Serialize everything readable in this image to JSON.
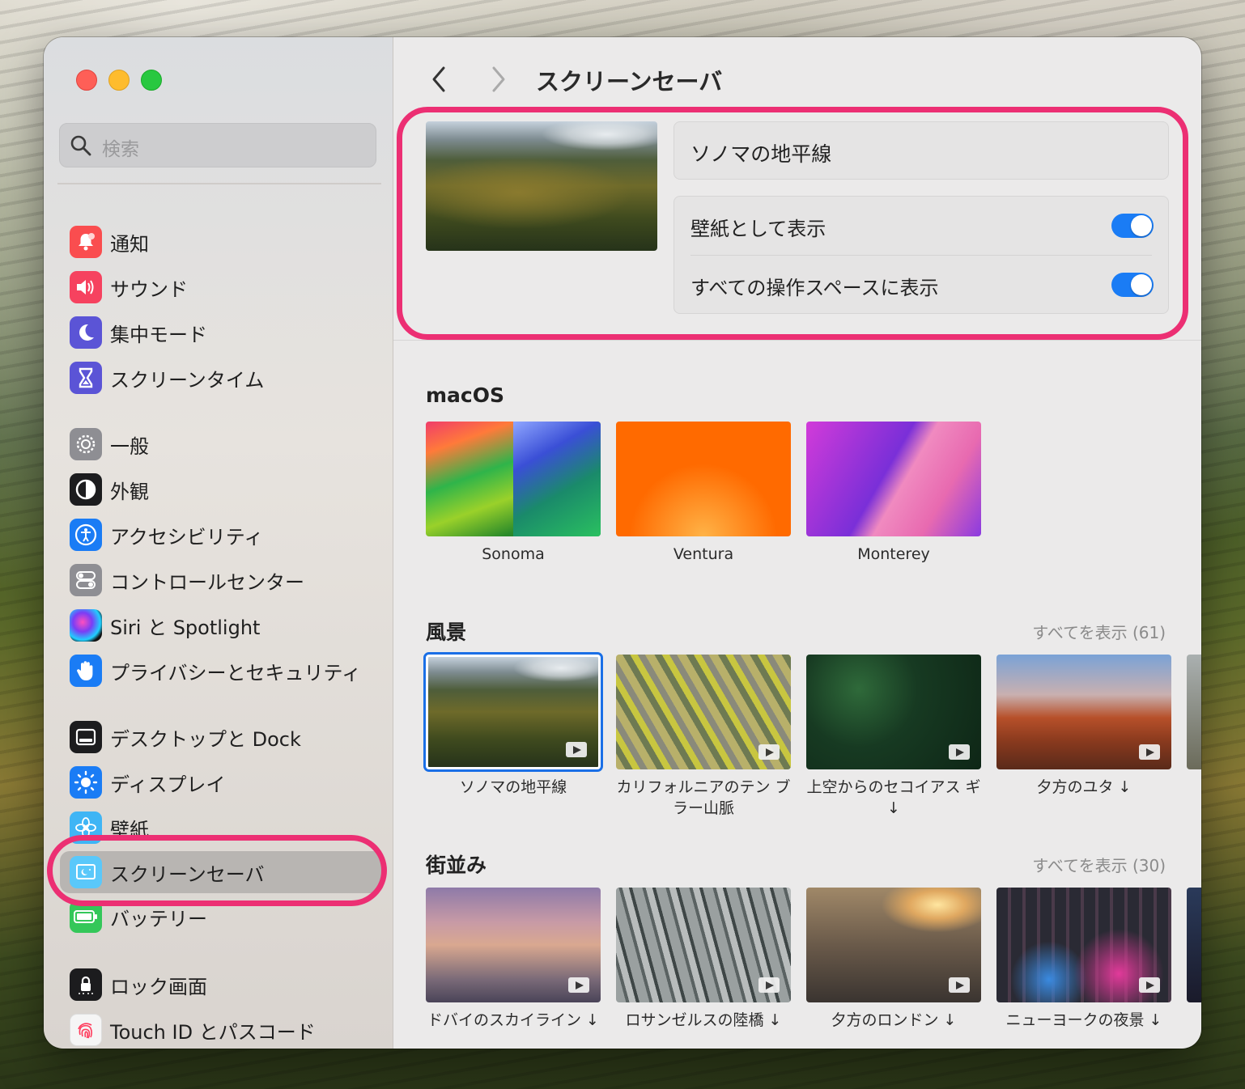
{
  "search": {
    "placeholder": "検索"
  },
  "sidebar": {
    "items": [
      {
        "label": "通知",
        "icon": "bell-icon"
      },
      {
        "label": "サウンド",
        "icon": "speaker-icon"
      },
      {
        "label": "集中モード",
        "icon": "moon-icon"
      },
      {
        "label": "スクリーンタイム",
        "icon": "hourglass-icon"
      },
      {
        "label": "一般",
        "icon": "gear-icon"
      },
      {
        "label": "外観",
        "icon": "appearance-icon"
      },
      {
        "label": "アクセシビリティ",
        "icon": "accessibility-icon"
      },
      {
        "label": "コントロールセンター",
        "icon": "toggles-icon"
      },
      {
        "label": "Siri と Spotlight",
        "icon": "siri-icon"
      },
      {
        "label": "プライバシーとセキュリティ",
        "icon": "hand-icon"
      },
      {
        "label": "デスクトップと Dock",
        "icon": "dock-icon"
      },
      {
        "label": "ディスプレイ",
        "icon": "brightness-icon"
      },
      {
        "label": "壁紙",
        "icon": "flower-icon"
      },
      {
        "label": "スクリーンセーバ",
        "icon": "screensaver-icon"
      },
      {
        "label": "バッテリー",
        "icon": "battery-icon"
      },
      {
        "label": "ロック画面",
        "icon": "lock-icon"
      },
      {
        "label": "Touch ID とパスコード",
        "icon": "fingerprint-icon"
      }
    ],
    "selected_index": 13
  },
  "header": {
    "title": "スクリーンセーバ",
    "back_icon": "chevron-left-icon",
    "forward_icon": "chevron-right-icon"
  },
  "current": {
    "name": "ソノマの地平線",
    "options": [
      {
        "label": "壁紙として表示",
        "on": true
      },
      {
        "label": "すべての操作スペースに表示",
        "on": true
      }
    ]
  },
  "sections": {
    "macos": {
      "title": "macOS",
      "tiles": [
        {
          "caption": "Sonoma"
        },
        {
          "caption": "Ventura"
        },
        {
          "caption": "Monterey"
        }
      ]
    },
    "landscape": {
      "title": "風景",
      "show_all": "すべてを表示 (61)",
      "tiles": [
        {
          "caption": "ソノマの地平線"
        },
        {
          "caption": "カリフォルニアのテン ブラー山脈"
        },
        {
          "caption": "上空からのセコイアス ギ ↓"
        },
        {
          "caption": "夕方のユタ ↓"
        }
      ]
    },
    "cityscape": {
      "title": "街並み",
      "show_all": "すべてを表示 (30)",
      "tiles": [
        {
          "caption": "ドバイのスカイライン ↓"
        },
        {
          "caption": "ロサンゼルスの陸橋 ↓"
        },
        {
          "caption": "夕方のロンドン ↓"
        },
        {
          "caption": "ニューヨークの夜景 ↓"
        }
      ]
    }
  },
  "colors": {
    "accent": "#1a7cf5",
    "highlight": "#ec2f73"
  }
}
